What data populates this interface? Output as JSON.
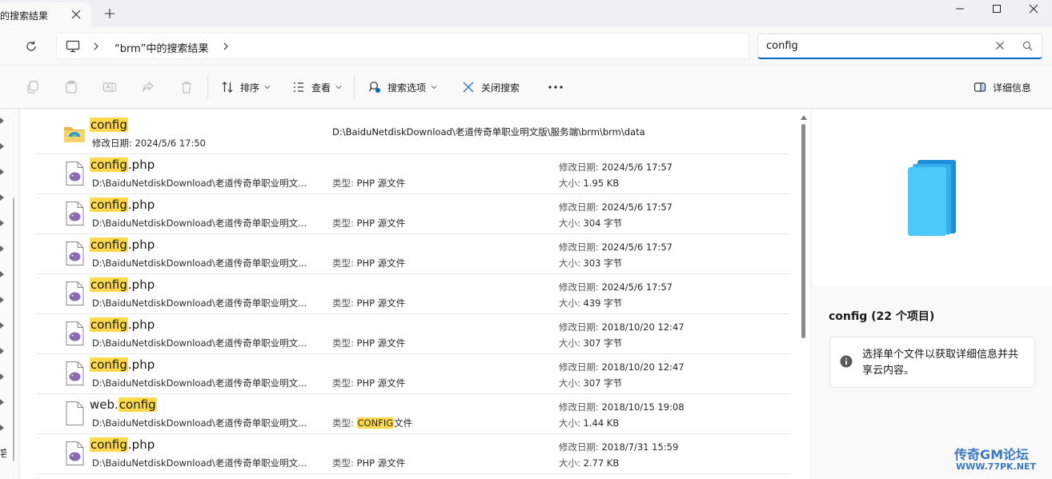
{
  "tab": {
    "title": "的搜索结果"
  },
  "address": {
    "breadcrumb": "“brm”中的搜索结果"
  },
  "search": {
    "value": "config"
  },
  "toolbar": {
    "sort": "排序",
    "view": "查看",
    "search_options": "搜索选项",
    "close_search": "关闭搜索",
    "details": "详细信息"
  },
  "nav": {
    "truncated_label": "容"
  },
  "files": [
    {
      "pre": "",
      "hl": "config",
      "post": "",
      "icon": "folder-icon",
      "sub": "修改日期: 2024/5/6 17:50",
      "path": "D:\\BaiduNetdiskDownload\\老道传奇单职业明文版\\服务端\\brm\\brm\\data"
    },
    {
      "pre": "",
      "hl": "config",
      "post": ".php",
      "icon": "php-file-icon",
      "sub": "D:\\BaiduNetdiskDownload\\老道传奇单职业明文...",
      "type_k": "类型: ",
      "type_hl": "",
      "type_v": "PHP 源文件",
      "mod_k": "修改日期: ",
      "mod": "2024/5/6 17:57",
      "size_k": "大小: ",
      "size": "1.95 KB"
    },
    {
      "pre": "",
      "hl": "config",
      "post": ".php",
      "icon": "php-file-icon",
      "sub": "D:\\BaiduNetdiskDownload\\老道传奇单职业明文...",
      "type_k": "类型: ",
      "type_hl": "",
      "type_v": "PHP 源文件",
      "mod_k": "修改日期: ",
      "mod": "2024/5/6 17:57",
      "size_k": "大小: ",
      "size": "304 字节"
    },
    {
      "pre": "",
      "hl": "config",
      "post": ".php",
      "icon": "php-file-icon",
      "sub": "D:\\BaiduNetdiskDownload\\老道传奇单职业明文...",
      "type_k": "类型: ",
      "type_hl": "",
      "type_v": "PHP 源文件",
      "mod_k": "修改日期: ",
      "mod": "2024/5/6 17:57",
      "size_k": "大小: ",
      "size": "303 字节"
    },
    {
      "pre": "",
      "hl": "config",
      "post": ".php",
      "icon": "php-file-icon",
      "sub": "D:\\BaiduNetdiskDownload\\老道传奇单职业明文...",
      "type_k": "类型: ",
      "type_hl": "",
      "type_v": "PHP 源文件",
      "mod_k": "修改日期: ",
      "mod": "2024/5/6 17:57",
      "size_k": "大小: ",
      "size": "439 字节"
    },
    {
      "pre": "",
      "hl": "config",
      "post": ".php",
      "icon": "php-file-icon",
      "sub": "D:\\BaiduNetdiskDownload\\老道传奇单职业明文...",
      "type_k": "类型: ",
      "type_hl": "",
      "type_v": "PHP 源文件",
      "mod_k": "修改日期: ",
      "mod": "2018/10/20 12:47",
      "size_k": "大小: ",
      "size": "307 字节"
    },
    {
      "pre": "",
      "hl": "config",
      "post": ".php",
      "icon": "php-file-icon",
      "sub": "D:\\BaiduNetdiskDownload\\老道传奇单职业明文...",
      "type_k": "类型: ",
      "type_hl": "",
      "type_v": "PHP 源文件",
      "mod_k": "修改日期: ",
      "mod": "2018/10/20 12:47",
      "size_k": "大小: ",
      "size": "307 字节"
    },
    {
      "pre": "web.",
      "hl": "config",
      "post": "",
      "icon": "blank-file-icon",
      "sub": "D:\\BaiduNetdiskDownload\\老道传奇单职业明文...",
      "type_k": "类型: ",
      "type_hl": "CONFIG",
      "type_v": "文件",
      "mod_k": "修改日期: ",
      "mod": "2018/10/15 19:08",
      "size_k": "大小: ",
      "size": "1.44 KB"
    },
    {
      "pre": "",
      "hl": "config",
      "post": ".php",
      "icon": "php-file-icon",
      "sub": "D:\\BaiduNetdiskDownload\\老道传奇单职业明文...",
      "type_k": "类型: ",
      "type_hl": "",
      "type_v": "PHP 源文件",
      "mod_k": "修改日期: ",
      "mod": "2018/7/31 15:59",
      "size_k": "大小: ",
      "size": "2.77 KB"
    }
  ],
  "details_pane": {
    "title": "config (22 个项目)",
    "info": "选择单个文件以获取详细信息并共享云内容。"
  },
  "watermark": {
    "top": "传奇GM论坛",
    "bottom": "WWW.77PK.NET"
  },
  "colors": {
    "highlight": "#ffd94c",
    "accent": "#0067c0",
    "watermark": "#3a78c4"
  }
}
